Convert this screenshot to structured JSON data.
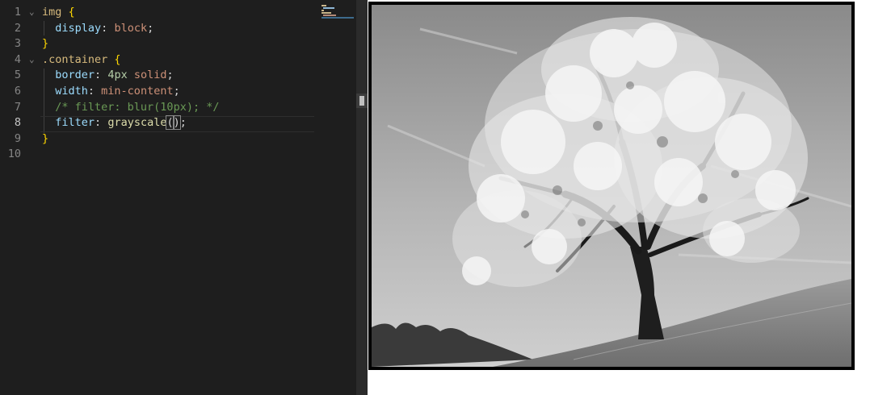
{
  "editor": {
    "lines": [
      {
        "num": "1",
        "tokens": [
          {
            "t": "img",
            "c": "sel"
          },
          {
            "t": " ",
            "c": "punc"
          },
          {
            "t": "{",
            "c": "brace"
          }
        ]
      },
      {
        "num": "2",
        "tokens": [
          {
            "t": "  ",
            "c": "punc"
          },
          {
            "t": "display",
            "c": "prop"
          },
          {
            "t": ": ",
            "c": "punc"
          },
          {
            "t": "block",
            "c": "val"
          },
          {
            "t": ";",
            "c": "punc"
          }
        ]
      },
      {
        "num": "3",
        "tokens": [
          {
            "t": "}",
            "c": "brace"
          }
        ]
      },
      {
        "num": "4",
        "tokens": [
          {
            "t": ".container",
            "c": "sel"
          },
          {
            "t": " ",
            "c": "punc"
          },
          {
            "t": "{",
            "c": "brace"
          }
        ]
      },
      {
        "num": "5",
        "tokens": [
          {
            "t": "  ",
            "c": "punc"
          },
          {
            "t": "border",
            "c": "prop"
          },
          {
            "t": ": ",
            "c": "punc"
          },
          {
            "t": "4px",
            "c": "num"
          },
          {
            "t": " ",
            "c": "punc"
          },
          {
            "t": "solid",
            "c": "val"
          },
          {
            "t": ";",
            "c": "punc"
          }
        ]
      },
      {
        "num": "6",
        "tokens": [
          {
            "t": "  ",
            "c": "punc"
          },
          {
            "t": "width",
            "c": "prop"
          },
          {
            "t": ": ",
            "c": "punc"
          },
          {
            "t": "min-content",
            "c": "val"
          },
          {
            "t": ";",
            "c": "punc"
          }
        ]
      },
      {
        "num": "7",
        "tokens": [
          {
            "t": "  ",
            "c": "punc"
          },
          {
            "t": "/* filter: blur(10px); */",
            "c": "cmt"
          }
        ]
      },
      {
        "num": "8",
        "tokens": [
          {
            "t": "  ",
            "c": "punc"
          },
          {
            "t": "filter",
            "c": "prop"
          },
          {
            "t": ": ",
            "c": "punc"
          },
          {
            "t": "grayscale",
            "c": "fn"
          },
          {
            "t": "(",
            "c": "punc paren-hl"
          },
          {
            "t": "|",
            "c": "caret"
          },
          {
            "t": ")",
            "c": "punc paren-hl"
          },
          {
            "t": ";",
            "c": "punc"
          }
        ]
      },
      {
        "num": "9",
        "tokens": [
          {
            "t": "}",
            "c": "brace"
          }
        ]
      },
      {
        "num": "10",
        "tokens": []
      }
    ],
    "active_line": "8",
    "fold_markers": [
      "1",
      "4"
    ],
    "fold_glyph": "⌄"
  },
  "preview": {
    "image_description_icon": "tree-photo",
    "filter": "grayscale"
  },
  "colors": {
    "editor_bg": "#1e1e1e",
    "selector": "#d7ba7d",
    "property": "#9cdcfe",
    "value": "#ce9178",
    "number": "#b5cea8",
    "function": "#dcdcaa",
    "comment": "#6a9955",
    "brace": "#ffd700"
  }
}
